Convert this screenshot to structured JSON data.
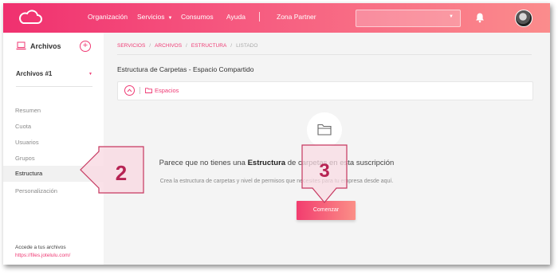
{
  "header": {
    "nav": [
      {
        "label": "Organización"
      },
      {
        "label": "Servicios"
      },
      {
        "label": "Consumos"
      },
      {
        "label": "Ayuda"
      },
      {
        "label": "Zona Partner"
      }
    ],
    "colors": {
      "accent": "#ef3a74",
      "gradient_start": "#f0306f",
      "gradient_end": "#fb8c8c"
    }
  },
  "sidebar": {
    "title": "Archivos",
    "selected_archive": "Archivos #1",
    "items": [
      {
        "label": "Resumen"
      },
      {
        "label": "Cuota"
      },
      {
        "label": "Usuarios"
      },
      {
        "label": "Grupos"
      },
      {
        "label": "Estructura"
      },
      {
        "label": "Personalización"
      }
    ],
    "footer_label": "Accede a tus archivos",
    "footer_link": "https://files.jotelulu.com/"
  },
  "breadcrumb": {
    "items": [
      {
        "label": "SERVICIOS"
      },
      {
        "label": "ARCHIVOS"
      },
      {
        "label": "ESTRUCTURA"
      }
    ],
    "current": "LISTADO"
  },
  "main": {
    "title": "Estructura de Carpetas - Espacio Compartido",
    "spaces_label": "Espacios",
    "empty_title_pre": "Parece que no tienes una ",
    "empty_title_bold": "Estructura",
    "empty_title_post": " de carpetas en esta suscripción",
    "empty_subtitle": "Crea la estructura de carpetas y nivel de permisos que necesites para tu empresa desde aquí.",
    "start_button": "Comenzar"
  },
  "callouts": [
    {
      "number": "2"
    },
    {
      "number": "3"
    }
  ]
}
